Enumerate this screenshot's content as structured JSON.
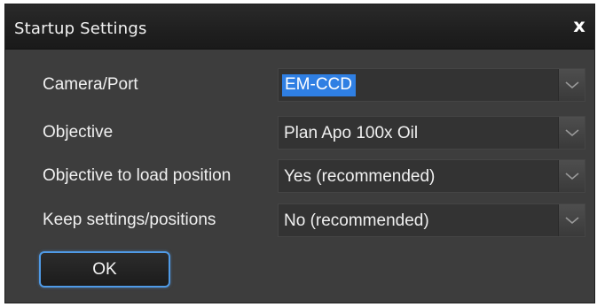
{
  "dialog": {
    "title": "Startup Settings",
    "close_label": "x"
  },
  "settings": [
    {
      "label": "Camera/Port",
      "value": "EM-CCD",
      "selected": true
    },
    {
      "label": "Objective",
      "value": "Plan Apo 100x Oil",
      "selected": false
    },
    {
      "label": "Objective to load position",
      "value": "Yes (recommended)",
      "selected": false
    },
    {
      "label": "Keep settings/positions",
      "value": "No (recommended)",
      "selected": false
    }
  ],
  "buttons": {
    "ok_label": "OK"
  },
  "colors": {
    "dialog_bg": "#3d3d3d",
    "titlebar_bg": "#1f1f1f",
    "selection": "#2f7fe3",
    "focus_border": "#4f9ae6"
  },
  "icons": {
    "close": "close-icon",
    "dropdown": "chevron-down-icon"
  }
}
